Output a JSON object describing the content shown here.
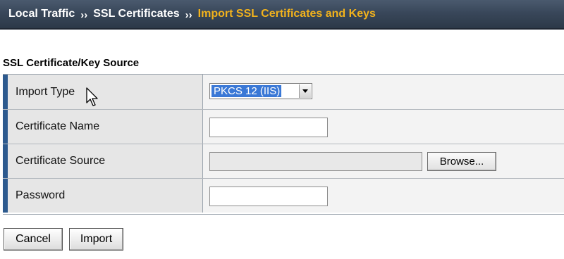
{
  "breadcrumb": {
    "items": [
      "Local Traffic",
      "SSL Certificates",
      "Import SSL Certificates and Keys"
    ],
    "separator": "››"
  },
  "section": {
    "title": "SSL Certificate/Key Source"
  },
  "form": {
    "rows": [
      {
        "label": "Import Type",
        "control": "select",
        "value": "PKCS 12 (IIS)"
      },
      {
        "label": "Certificate Name",
        "control": "text",
        "value": ""
      },
      {
        "label": "Certificate Source",
        "control": "file",
        "value": "",
        "button_label": "Browse..."
      },
      {
        "label": "Password",
        "control": "password",
        "value": ""
      }
    ]
  },
  "actions": {
    "cancel_label": "Cancel",
    "import_label": "Import"
  },
  "colors": {
    "header_bg": "#39475a",
    "current_crumb": "#f2b21c",
    "row_accent": "#2d5a8e",
    "select_highlight": "#3a78d6"
  }
}
